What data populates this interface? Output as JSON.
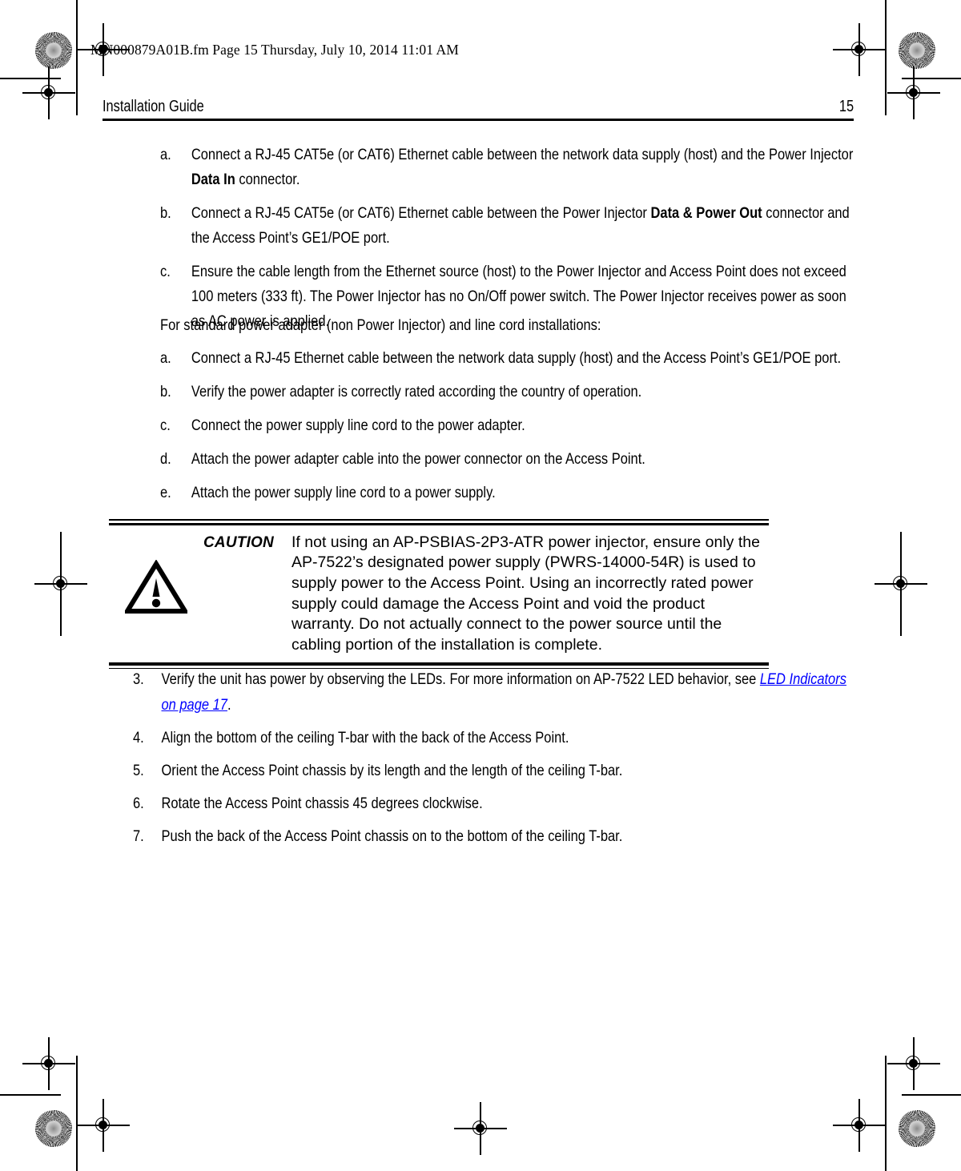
{
  "filestamp": "MN000879A01B.fm  Page 15  Thursday, July 10, 2014  11:01 AM",
  "header": {
    "title": "Installation Guide",
    "page_number": "15"
  },
  "poe_steps": {
    "items": [
      {
        "marker": "a.",
        "text_before": "Connect a RJ-45 CAT5e (or CAT6) Ethernet cable between the network data supply (host) and the Power Injector ",
        "bold": "Data In",
        "text_after": " connector."
      },
      {
        "marker": "b.",
        "text_before": "Connect a RJ-45 CAT5e (or CAT6) Ethernet cable between the Power Injector ",
        "bold": "Data & Power Out",
        "text_after": " connector and the Access Point’s GE1/POE port."
      },
      {
        "marker": "c.",
        "text_before": "Ensure the cable length from the Ethernet source (host) to the Power Injector and Access Point does not exceed 100 meters (333 ft). The Power Injector has no On/Off power switch. The Power Injector receives power as soon as AC power is applied.",
        "bold": "",
        "text_after": ""
      }
    ]
  },
  "standard_intro": "For standard power adapter (non Power Injector) and line cord installations:",
  "adapter_steps": {
    "items": [
      {
        "marker": "a.",
        "text": "Connect a RJ-45 Ethernet cable between the network data supply (host) and the Access Point’s GE1/POE port."
      },
      {
        "marker": "b.",
        "text": "Verify the power adapter is correctly rated according the country of operation."
      },
      {
        "marker": "c.",
        "text": "Connect the power supply line cord to the power adapter."
      },
      {
        "marker": "d.",
        "text": "Attach the power adapter cable into the power connector on the Access Point."
      },
      {
        "marker": "e.",
        "text": "Attach the power supply line cord to a power supply."
      }
    ]
  },
  "caution": {
    "icon": "warning-triangle-icon",
    "label": "CAUTION",
    "text": "If not using an AP-PSBIAS-2P3-ATR power injector, ensure only the AP-7522’s designated power supply (PWRS-14000-54R) is used to supply power to the Access Point. Using an incorrectly rated power supply could damage the Access Point and void the product warranty. Do not actually connect to the power source until the cabling portion of the installation is complete."
  },
  "numbered_steps": {
    "items": [
      {
        "marker": "3.",
        "text_before": "Verify the unit has power by observing the LEDs. For more information on AP-7522 LED behavior, see ",
        "link": "LED Indicators on page 17",
        "text_after": "."
      },
      {
        "marker": "4.",
        "text_before": "Align the bottom of the ceiling T-bar with the back of the Access Point.",
        "link": "",
        "text_after": ""
      },
      {
        "marker": "5.",
        "text_before": "Orient the Access Point chassis by its length and the length of the ceiling T-bar.",
        "link": "",
        "text_after": ""
      },
      {
        "marker": "6.",
        "text_before": "Rotate the Access Point chassis 45 degrees clockwise.",
        "link": "",
        "text_after": ""
      },
      {
        "marker": "7.",
        "text_before": "Push the back of the Access Point chassis on to the bottom of the ceiling T-bar.",
        "link": "",
        "text_after": ""
      }
    ]
  },
  "colors": {
    "xref_link": "#0000FF",
    "text": "#000000",
    "rule": "#000000"
  }
}
